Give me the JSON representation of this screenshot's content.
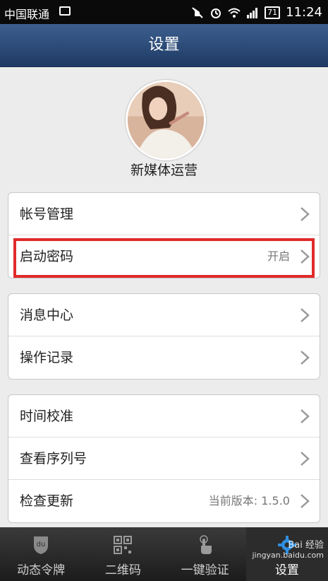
{
  "status_bar": {
    "carrier": "中国联通",
    "battery": "71",
    "time": "11:24"
  },
  "header": {
    "title": "设置"
  },
  "profile": {
    "name": "新媒体运营"
  },
  "groups": [
    {
      "rows": [
        {
          "label": "帐号管理",
          "value": ""
        },
        {
          "label": "启动密码",
          "value": "开启"
        }
      ]
    },
    {
      "rows": [
        {
          "label": "消息中心",
          "value": ""
        },
        {
          "label": "操作记录",
          "value": ""
        }
      ]
    },
    {
      "rows": [
        {
          "label": "时间校准",
          "value": ""
        },
        {
          "label": "查看序列号",
          "value": ""
        },
        {
          "label": "检查更新",
          "value": "当前版本: 1.5.0"
        }
      ]
    }
  ],
  "tabs": [
    {
      "label": "动态令牌",
      "icon": "shield-du-icon"
    },
    {
      "label": "二维码",
      "icon": "qr-code-icon"
    },
    {
      "label": "一键验证",
      "icon": "touch-hand-icon"
    },
    {
      "label": "设置",
      "icon": "gear-icon"
    }
  ],
  "watermark": {
    "line1": "Bai 经验",
    "line2": "jingyan.baidu.com"
  },
  "colors": {
    "header": "#2b4a78",
    "highlight": "#e02a2a",
    "tabbar": "#2a2a2a"
  }
}
